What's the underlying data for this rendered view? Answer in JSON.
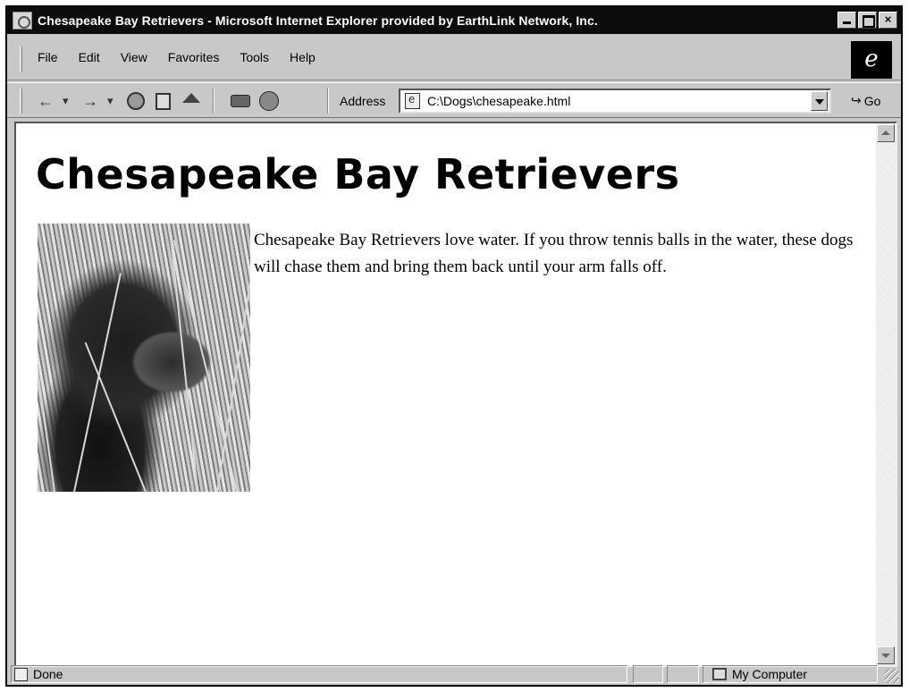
{
  "window": {
    "title": "Chesapeake Bay Retrievers - Microsoft Internet Explorer provided by EarthLink Network, Inc.",
    "controls": {
      "minimize": "",
      "maximize": "",
      "close": "×"
    }
  },
  "menu": {
    "items": [
      {
        "label": "File"
      },
      {
        "label": "Edit"
      },
      {
        "label": "View"
      },
      {
        "label": "Favorites"
      },
      {
        "label": "Tools"
      },
      {
        "label": "Help"
      }
    ]
  },
  "toolbar": {
    "back_icon": "←",
    "back_menu": "▾",
    "forward_icon": "→",
    "forward_menu": "▾",
    "address_label": "Address",
    "address_value": "C:\\Dogs\\chesapeake.html",
    "go_icon": "↪",
    "go_label": "Go"
  },
  "page": {
    "heading": "Chesapeake Bay Retrievers",
    "paragraph": "Chesapeake Bay Retrievers love water. If you throw tennis balls in the water, these dogs will chase them and bring them back until your arm falls off."
  },
  "status": {
    "text": "Done",
    "zone": "My Computer"
  },
  "icons": {
    "stop": "stop-icon",
    "refresh": "refresh-icon",
    "home": "home-icon",
    "print": "print-icon",
    "mail": "mail-icon"
  }
}
